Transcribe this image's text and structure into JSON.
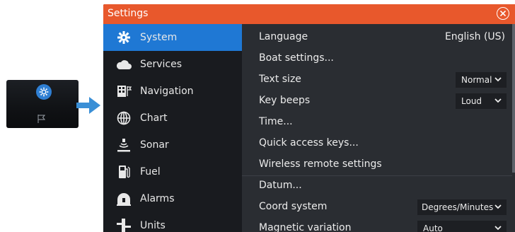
{
  "window": {
    "title": "Settings"
  },
  "sidebar": {
    "items": [
      {
        "label": "System",
        "icon": "gear-icon",
        "active": true
      },
      {
        "label": "Services",
        "icon": "cloud-icon"
      },
      {
        "label": "Navigation",
        "icon": "navigation-icon"
      },
      {
        "label": "Chart",
        "icon": "globe-icon"
      },
      {
        "label": "Sonar",
        "icon": "sonar-icon"
      },
      {
        "label": "Fuel",
        "icon": "fuel-pump-icon"
      },
      {
        "label": "Alarms",
        "icon": "alarm-icon"
      },
      {
        "label": "Units",
        "icon": "units-icon"
      }
    ]
  },
  "settings": {
    "language": {
      "label": "Language",
      "value": "English (US)"
    },
    "boat_settings": {
      "label": "Boat settings..."
    },
    "text_size": {
      "label": "Text size",
      "value": "Normal"
    },
    "key_beeps": {
      "label": "Key beeps",
      "value": "Loud"
    },
    "time": {
      "label": "Time..."
    },
    "quick_access": {
      "label": "Quick access keys..."
    },
    "wireless_remote": {
      "label": "Wireless remote settings"
    },
    "datum": {
      "label": "Datum..."
    },
    "coord_system": {
      "label": "Coord system",
      "value": "Degrees/Minutes"
    },
    "magnetic_variation": {
      "label": "Magnetic variation",
      "value": "Auto"
    }
  },
  "colors": {
    "titlebar": "#e8582c",
    "active": "#1f78d4",
    "arrow": "#3a8fd6"
  }
}
